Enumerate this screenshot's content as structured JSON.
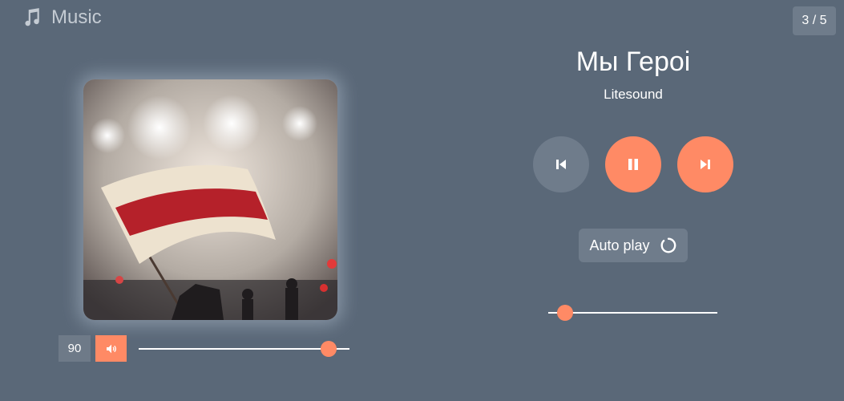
{
  "header": {
    "icon": "music-note-icon",
    "title": "Music",
    "counter": "3 / 5"
  },
  "song": {
    "title": "Мы Героі",
    "artist": "Litesound"
  },
  "controls": {
    "prev_icon": "skip-previous-icon",
    "play_icon": "pause-icon",
    "next_icon": "skip-next-icon"
  },
  "autoplay": {
    "label": "Auto play",
    "icon": "loop-icon"
  },
  "volume": {
    "value": "90",
    "level": 0.9,
    "icon": "speaker-icon"
  },
  "progress": {
    "position": 0.1
  },
  "colors": {
    "background": "#5a6878",
    "accent": "#ff8a65",
    "muted_button": "#6f7c8b"
  }
}
